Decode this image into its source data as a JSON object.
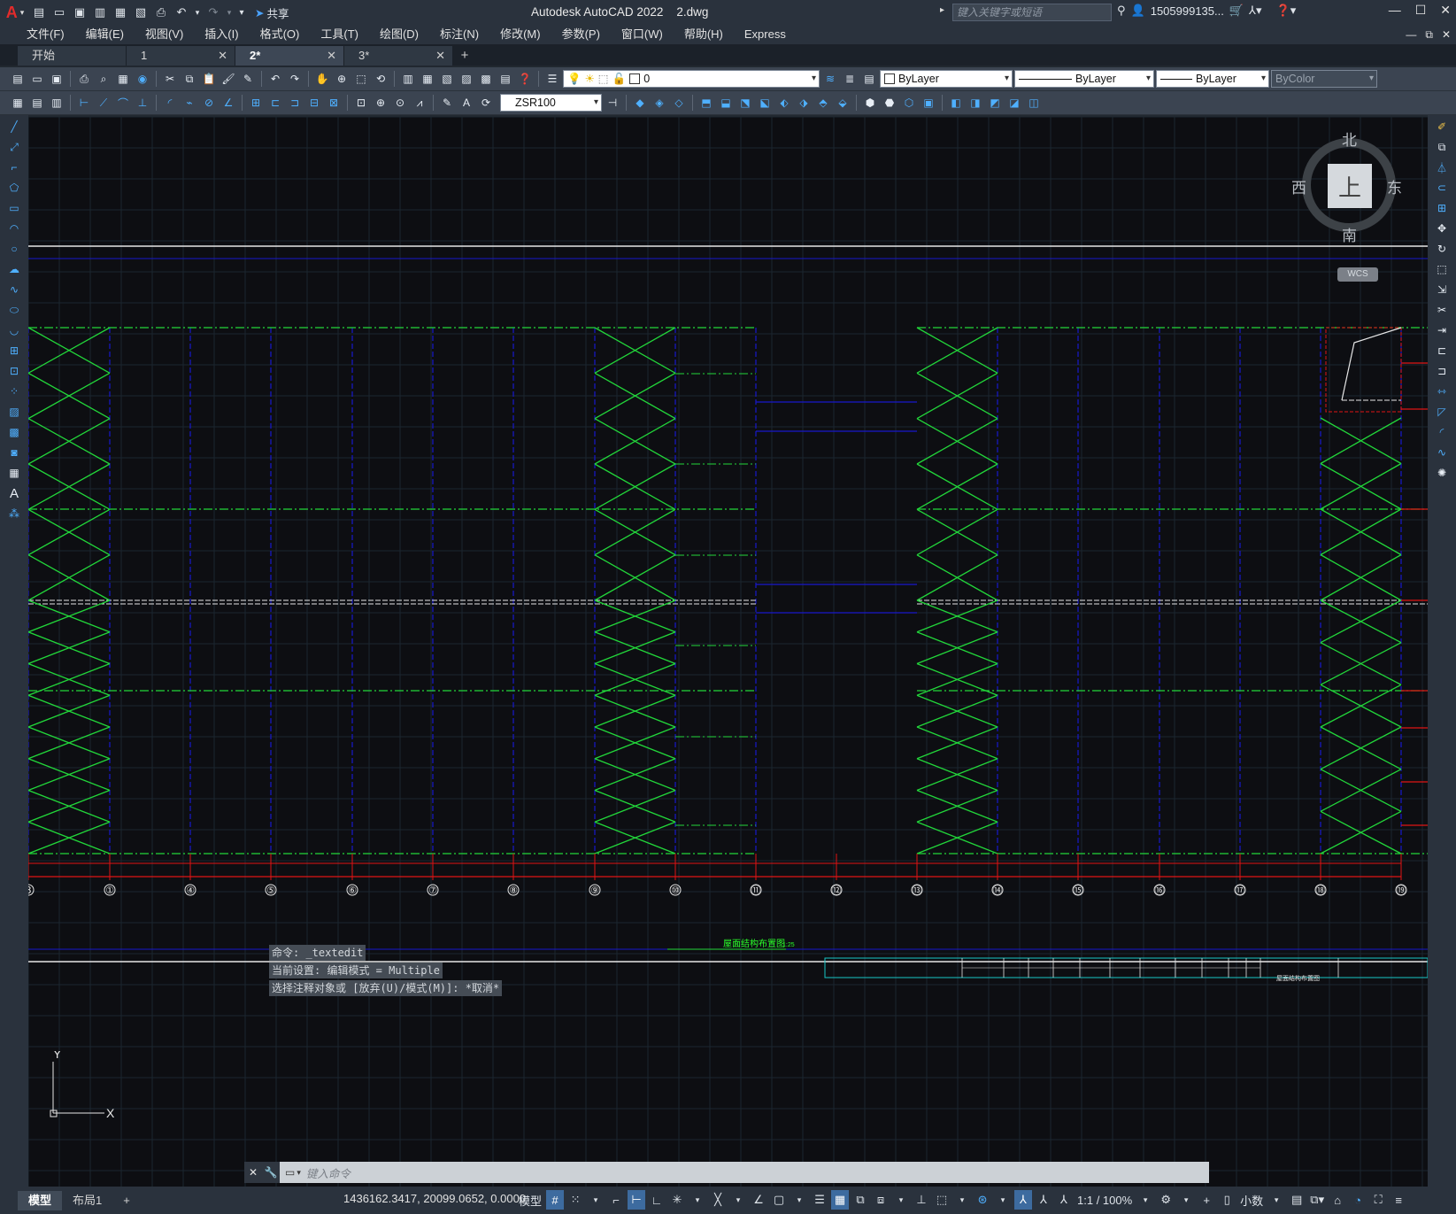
{
  "app": {
    "title": "Autodesk AutoCAD 2022",
    "filename": "2.dwg",
    "logo": "A",
    "share_label": "共享"
  },
  "search": {
    "placeholder": "键入关键字或短语"
  },
  "user": {
    "name": "1505999135..."
  },
  "menus": [
    "文件(F)",
    "编辑(E)",
    "视图(V)",
    "插入(I)",
    "格式(O)",
    "工具(T)",
    "绘图(D)",
    "标注(N)",
    "修改(M)",
    "参数(P)",
    "窗口(W)",
    "帮助(H)",
    "Express"
  ],
  "tabs": [
    {
      "label": "开始",
      "closable": false
    },
    {
      "label": "1",
      "closable": true
    },
    {
      "label": "2*",
      "closable": true,
      "active": true
    },
    {
      "label": "3*",
      "closable": true
    }
  ],
  "toolbar": {
    "layer_value": "0",
    "color_value": "ByLayer",
    "linetype_value": "ByLayer",
    "lineweight_value": "ByLayer",
    "plotstyle_value": "ByColor",
    "dimstyle_value": "ZSR100"
  },
  "viewcube": {
    "north": "北",
    "south": "南",
    "east": "东",
    "west": "西",
    "face": "上",
    "wcs": "WCS"
  },
  "ucs": {
    "x": "X",
    "y": "Y"
  },
  "drawing": {
    "axis_labels": [
      "8",
      "①",
      "④",
      "⑤",
      "⑥",
      "⑦",
      "⑧",
      "⑨",
      "⑩",
      "⑪",
      "⑫",
      "⑬",
      "⑭",
      "⑮",
      "⑯",
      "⑰",
      "⑱",
      "⑲"
    ],
    "drawing_title": "屋面结构布置图",
    "drawing_scale": "1:25",
    "titleblock_title": "屋面结构布置图"
  },
  "command": {
    "history": [
      "命令: _textedit",
      "当前设置: 编辑模式 = Multiple",
      "选择注释对象或 [放弃(U)/模式(M)]: *取消*"
    ],
    "placeholder": "键入命令"
  },
  "status": {
    "model_tab": "模型",
    "layout_tab": "布局1",
    "coords": "1436162.3417, 20099.0652, 0.0000",
    "model_label": "模型",
    "scale": "1:1 / 100%",
    "units": "小数"
  },
  "colors": {
    "bg": "#0d0e12",
    "grid": "#1c2630",
    "brace": "#22d63a",
    "beam": "#1818cc",
    "axis": "#e01414",
    "white": "#e6e6e6"
  }
}
